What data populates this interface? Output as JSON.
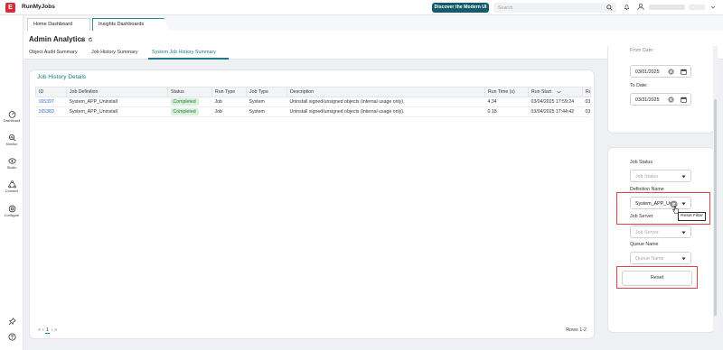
{
  "app": {
    "logo_letter": "E",
    "title": "RunMyJobs"
  },
  "topbar": {
    "modern_ui_label": "Discover the Modern UI",
    "search_placeholder": "Search",
    "icons": [
      "search-icon",
      "bell-icon",
      "user-icon",
      "chevron-down-icon"
    ]
  },
  "nav": {
    "items": [
      {
        "label": "Dashboard",
        "icon": "dashboard-icon"
      },
      {
        "label": "Monitor",
        "icon": "monitor-icon"
      },
      {
        "label": "Studio",
        "icon": "studio-icon"
      },
      {
        "label": "Connect",
        "icon": "connect-icon"
      },
      {
        "label": "Configure",
        "icon": "configure-icon"
      }
    ],
    "bottom_icons": [
      "pin-icon",
      "help-icon"
    ]
  },
  "dashboard_tabs": [
    "Home Dashboard",
    "Insights Dashboards"
  ],
  "page": {
    "title": "Admin Analytics",
    "subtabs": [
      "Object Audit Summary",
      "Job History Summary",
      "System Job History Summary"
    ],
    "active_subtab": "System Job History Summary"
  },
  "panel": {
    "title": "Job History Details",
    "columns": [
      "ID",
      "Job Definition",
      "Status",
      "Run Type",
      "Job Type",
      "Description",
      "Run Time (s)",
      "Run Start",
      "Ru"
    ],
    "rows": [
      [
        "165397",
        "System_APP_Uninstall",
        "Completed",
        "Job",
        "System",
        "Uninstall signed/unsigned objects (internal usage only).",
        "4.34",
        "03/04/2025 17:59:24",
        "03"
      ],
      [
        "165383",
        "System_APP_Uninstall",
        "Completed",
        "Job",
        "System",
        "Uninstall signed/unsigned objects (internal usage only).",
        "0.18",
        "03/04/2025 17:44:42",
        "03"
      ]
    ],
    "pager": {
      "first": "«",
      "prev": "‹",
      "current": "1",
      "next": "›",
      "last": "»"
    },
    "rows_count": "Rows 1-2"
  },
  "filters": {
    "from_date_label": "From Date:",
    "from_date": "03/01/2025",
    "to_date_label": "To Date:",
    "to_date": "03/31/2025",
    "job_status_label": "Job Status",
    "job_status_placeholder": "Job Status",
    "definition_name_label": "Definition Name",
    "definition_name_value": "System_APP_Uni",
    "tooltip": "Reset Filter",
    "job_server_label": "Job Server",
    "job_server_placeholder": "Job Server",
    "queue_name_label": "Queue Name",
    "queue_name_placeholder": "Queue Name",
    "reset_label": "Reset"
  },
  "colors": {
    "accent": "#1b7a86",
    "highlight": "#e0424b",
    "brand": "#d62d3a",
    "completed_bg": "#d8f0dc"
  }
}
